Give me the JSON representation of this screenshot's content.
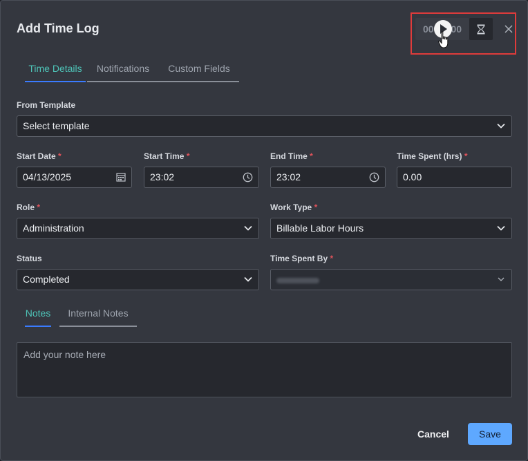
{
  "dialog": {
    "title": "Add Time Log"
  },
  "timer": {
    "value": "00:00:00"
  },
  "tabs": [
    {
      "label": "Time Details",
      "active": true
    },
    {
      "label": "Notifications",
      "active": false
    },
    {
      "label": "Custom Fields",
      "active": false
    }
  ],
  "from_template": {
    "label": "From Template",
    "value": "Select template"
  },
  "start_date": {
    "label": "Start Date",
    "value": "04/13/2025"
  },
  "start_time": {
    "label": "Start Time",
    "value": "23:02"
  },
  "end_time": {
    "label": "End Time",
    "value": "23:02"
  },
  "time_spent": {
    "label": "Time Spent (hrs)",
    "value": "0.00"
  },
  "role": {
    "label": "Role",
    "value": "Administration"
  },
  "work_type": {
    "label": "Work Type",
    "value": "Billable Labor Hours"
  },
  "status": {
    "label": "Status",
    "value": "Completed"
  },
  "time_spent_by": {
    "label": "Time Spent By",
    "value": ""
  },
  "notes_tabs": [
    {
      "label": "Notes",
      "active": true
    },
    {
      "label": "Internal Notes",
      "active": false
    }
  ],
  "notes": {
    "placeholder": "Add your note here"
  },
  "footer": {
    "cancel_label": "Cancel",
    "save_label": "Save"
  },
  "required_marker": "*",
  "colors": {
    "accent_tab": "#4ec4b8",
    "tab_underline": "#3a7bff",
    "save_button": "#5ea8ff",
    "highlight_box": "#e03b3b",
    "required": "#e0535b"
  }
}
